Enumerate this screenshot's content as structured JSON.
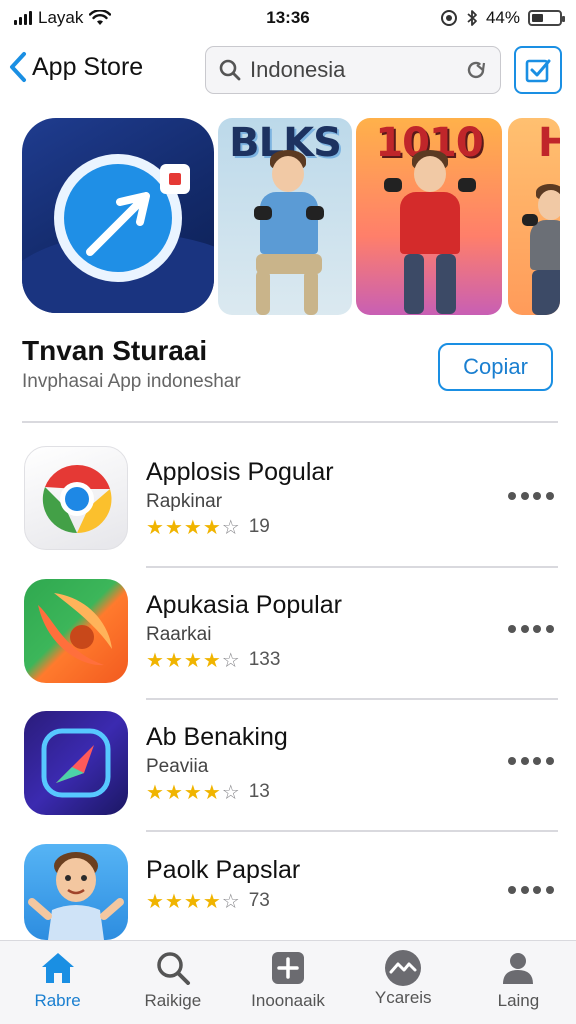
{
  "status_bar": {
    "carrier": "Layak",
    "time": "13:36",
    "battery": "44%",
    "battery_level": 0.44
  },
  "nav": {
    "back_label": "App Store",
    "search_value": "Indonesia"
  },
  "featured": {
    "screenshot_texts": [
      "BLKS",
      "1010",
      "H"
    ],
    "title": "Tnvan Sturaai",
    "subtitle": "Invphasai App indoneshar",
    "get_label": "Copiar"
  },
  "apps": [
    {
      "name": "Applosis Pogular",
      "subtitle": "Rapkinar",
      "rating": 3.5,
      "count": "19"
    },
    {
      "name": "Apukasia Popular",
      "subtitle": "Raarkai",
      "rating": 4,
      "count": "133"
    },
    {
      "name": "Ab Benaking",
      "subtitle": "Peaviia",
      "rating": 3.5,
      "count": "13"
    },
    {
      "name": "Paolk Papslar",
      "subtitle": "",
      "rating": 4,
      "count": "73"
    }
  ],
  "tabs": [
    {
      "label": "Rabre",
      "icon": "home-icon",
      "active": true
    },
    {
      "label": "Raikige",
      "icon": "search-icon",
      "active": false
    },
    {
      "label": "Inoonaaik",
      "icon": "add-icon",
      "active": false
    },
    {
      "label": "Ycareis",
      "icon": "chart-icon",
      "active": false
    },
    {
      "label": "Laing",
      "icon": "person-icon",
      "active": false
    }
  ],
  "colors": {
    "accent": "#1a8fe3",
    "star": "#f0b400"
  }
}
